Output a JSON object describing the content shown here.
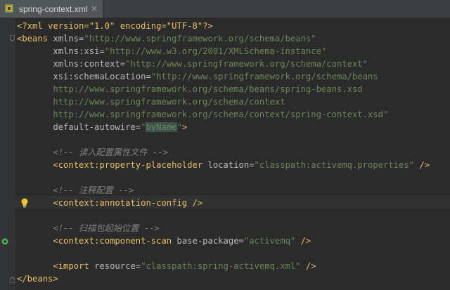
{
  "tab": {
    "title": "spring-context.xml",
    "close": "×"
  },
  "code": {
    "l1": "<?xml version=\"1.0\" encoding=\"UTF-8\"?>",
    "l2_tag": "<beans",
    "l2_attr": " xmlns=",
    "l2_val": "\"http://www.springframework.org/schema/beans\"",
    "l3_attr": "xmlns:xsi=",
    "l3_val": "\"http://www.w3.org/2001/XMLSchema-instance\"",
    "l4_attr": "xmlns:context=",
    "l4_val": "\"http://www.springframework.org/schema/context\"",
    "l5_attr": "xsi:schemaLocation=",
    "l5_val": "\"http://www.springframework.org/schema/beans",
    "l6_val": "http://www.springframework.org/schema/beans/spring-beans.xsd",
    "l7_val": "http://www.springframework.org/schema/context",
    "l8_val": "http://www.springframework.org/schema/context/spring-context.xsd\"",
    "l9_attr": "default-autowire=",
    "l9_q1": "\"",
    "l9_val": "byName",
    "l9_q2": "\"",
    "l9_end": ">",
    "c1": "<!-- 读入配置属性文件 -->",
    "l11_tag": "<context:property-placeholder",
    "l11_attr": " location=",
    "l11_val": "\"classpath:activemq.properties\"",
    "l11_end": " />",
    "c2": "<!-- 注释配置 -->",
    "l14_tag": "<context:annotation-config",
    "l14_end": " />",
    "c3": "<!-- 扫描包起始位置 -->",
    "l17_tag": "<context:component-scan",
    "l17_attr": " base-package=",
    "l17_val": "\"activemq\"",
    "l17_end": " />",
    "l19_tag": "<import",
    "l19_attr": " resource=",
    "l19_val": "\"classpath:spring-activemq.xml\"",
    "l19_end": " />",
    "l20_tag": "</beans>"
  },
  "colors": {
    "bg": "#2b2b2b",
    "tag": "#e8bf6a",
    "attr": "#bababa",
    "value": "#6a8759",
    "comment": "#808080"
  },
  "icons": [
    "xml-file-icon",
    "close-icon",
    "lightbulb-icon",
    "fold-icon",
    "spring-bean-icon"
  ]
}
